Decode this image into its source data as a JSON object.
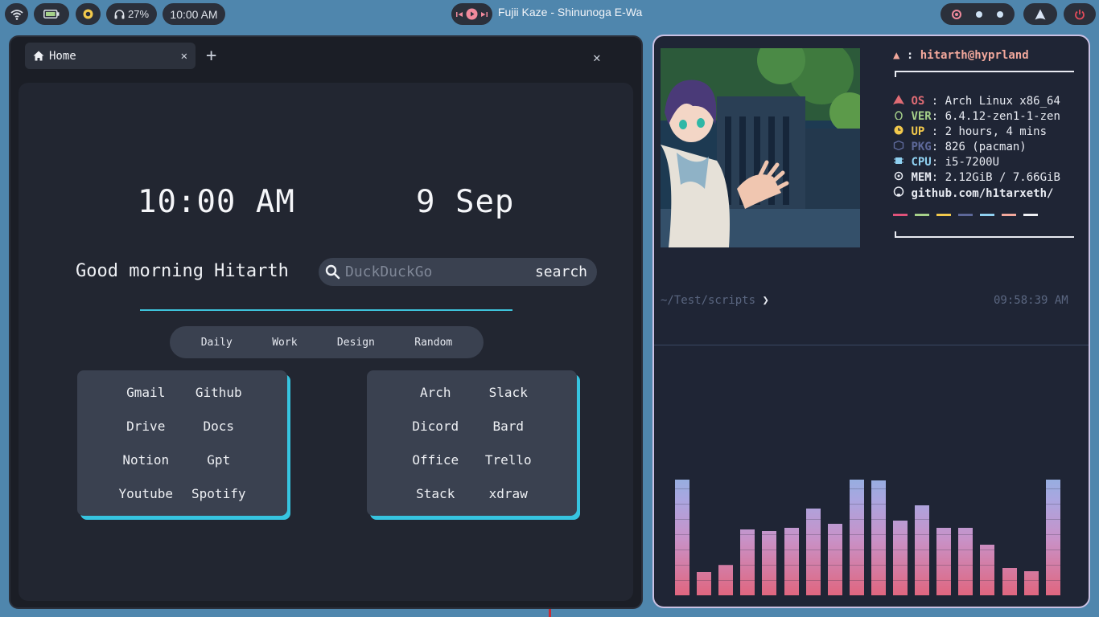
{
  "topbar": {
    "volume": "27%",
    "clock": "10:00 AM",
    "now_playing": "Fujii Kaze - Shinunoga E-Wa",
    "icons": [
      "wifi-icon",
      "battery-icon",
      "brightness-icon",
      "headphones-icon",
      "prev-icon",
      "play-icon",
      "next-icon",
      "record-icon",
      "arch-icon",
      "power-icon"
    ]
  },
  "browser": {
    "tab_label": "Home",
    "time": "10:00 AM",
    "date": "9 Sep",
    "greeting": "Good morning Hitarth",
    "search_placeholder": "DuckDuckGo",
    "search_button": "search",
    "categories": [
      "Daily",
      "Work",
      "Design",
      "Random"
    ],
    "links_left": [
      "Gmail",
      "Github",
      "Drive",
      "Docs",
      "Notion",
      "Gpt",
      "Youtube",
      "Spotify"
    ],
    "links_right": [
      "Arch",
      "Slack",
      "Dicord",
      "Bard",
      "Office",
      "Trello",
      "Stack",
      "xdraw"
    ]
  },
  "fetch": {
    "user": "hitarth",
    "host": "hyprland",
    "rows": [
      {
        "key": "OS",
        "sep": " : ",
        "value": "Arch Linux x86_64",
        "color": "#e06c75"
      },
      {
        "key": "VER",
        "sep": ": ",
        "value": "6.4.12-zen1-1-zen",
        "color": "#a6d18a"
      },
      {
        "key": "UP",
        "sep": " : ",
        "value": "2 hours, 4 mins",
        "color": "#f2c94c"
      },
      {
        "key": "PKG",
        "sep": ": ",
        "value": "826 (pacman)",
        "color": "#5d6899"
      },
      {
        "key": "CPU",
        "sep": ": ",
        "value": "i5-7200U",
        "color": "#8fd0f0"
      },
      {
        "key": "MEM",
        "sep": ": ",
        "value": "2.12GiB / 7.66GiB",
        "color": "#f2a89c"
      }
    ],
    "link": "github.com/h1tarxeth/",
    "palette": [
      "#e0527a",
      "#a6d18a",
      "#f2c94c",
      "#5d6899",
      "#8fd0f0",
      "#f2a89c",
      "#eef0f4"
    ]
  },
  "terminal": {
    "path": "~/Test/scripts",
    "time": "09:58:39 AM"
  },
  "visualizer": {
    "levels": [
      0.76,
      0.15,
      0.2,
      0.43,
      0.42,
      0.44,
      0.57,
      0.47,
      0.76,
      0.75,
      0.49,
      0.59,
      0.44,
      0.44,
      0.33,
      0.18,
      0.16,
      0.76
    ]
  }
}
